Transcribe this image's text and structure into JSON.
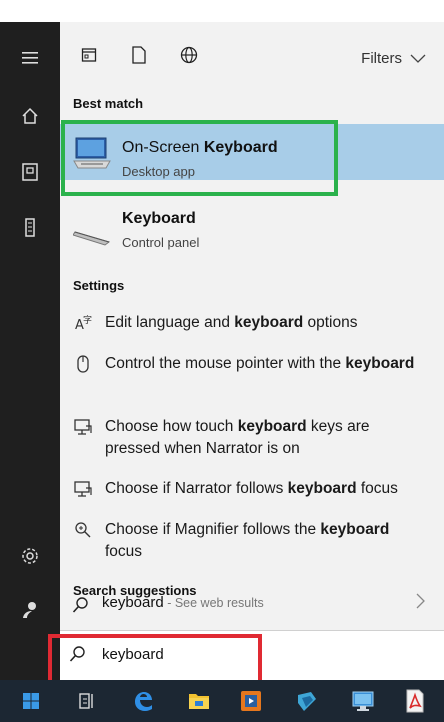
{
  "toolbar": {
    "filters_label": "Filters"
  },
  "sections": {
    "best_match": "Best match",
    "settings": "Settings",
    "search_suggestions": "Search suggestions"
  },
  "results": [
    {
      "title_pre": "On-Screen ",
      "title_bold": "Keyboard",
      "subtitle": "Desktop app",
      "selected": true,
      "icon": "keyboard-monitor-icon"
    },
    {
      "title_pre": "",
      "title_bold": "Keyboard",
      "subtitle": "Control panel",
      "selected": false,
      "icon": "keyboard-icon"
    }
  ],
  "settings": [
    {
      "icon": "language-icon",
      "parts": [
        [
          "Edit language and ",
          false
        ],
        [
          "keyboard",
          true
        ],
        [
          " options",
          false
        ]
      ]
    },
    {
      "icon": "mouse-icon",
      "parts": [
        [
          "Control the mouse pointer with the ",
          false
        ],
        [
          "keyboard",
          true
        ]
      ]
    },
    {
      "icon": "narrator-icon",
      "parts": [
        [
          "Choose how touch ",
          false
        ],
        [
          "keyboard",
          true
        ],
        [
          " keys are pressed when Narrator is on",
          false
        ]
      ]
    },
    {
      "icon": "narrator-icon",
      "parts": [
        [
          "Choose if Narrator follows ",
          false
        ],
        [
          "keyboard",
          true
        ],
        [
          " focus",
          false
        ]
      ]
    },
    {
      "icon": "magnifier-icon",
      "parts": [
        [
          "Choose if Magnifier follows the ",
          false
        ],
        [
          "keyboard",
          true
        ],
        [
          " focus",
          false
        ]
      ]
    }
  ],
  "suggestion": {
    "term": "keyboard",
    "hint": " - See web results"
  },
  "search": {
    "value": "keyboard"
  },
  "colors": {
    "selected_bg": "#a8cde8",
    "highlight_green": "#2bb24c",
    "highlight_red": "#e02a33",
    "rail_bg": "#1f1f1f",
    "taskbar_bg": "#1c2733"
  }
}
